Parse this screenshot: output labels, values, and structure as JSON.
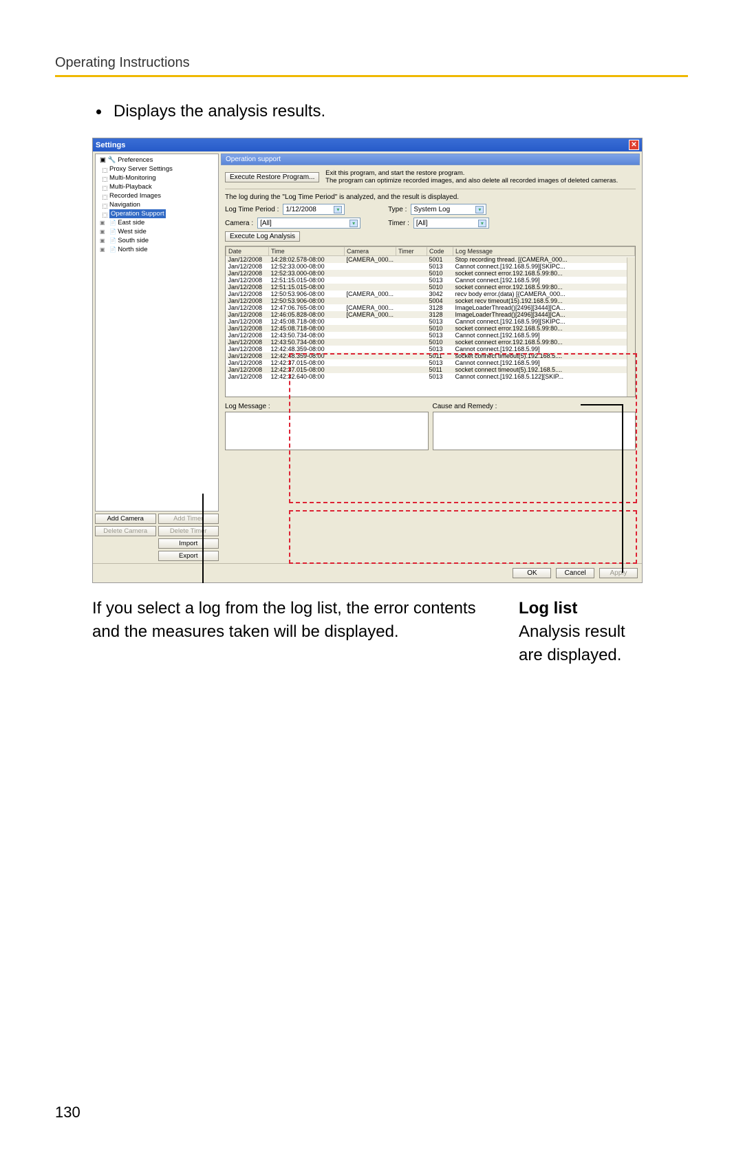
{
  "header": {
    "title": "Operating Instructions"
  },
  "bullet": "Displays the analysis results.",
  "window": {
    "title": "Settings",
    "section_title": "Operation support",
    "restore_btn": "Execute Restore Program...",
    "restore_desc1": "Exit this program, and start the restore program.",
    "restore_desc2": "The program can optimize recorded images, and also delete all recorded images of deleted cameras.",
    "analysis_note": "The log during the \"Log Time Period\" is analyzed, and the result is displayed.",
    "labels": {
      "log_time_period": "Log Time Period :",
      "type": "Type :",
      "camera": "Camera :",
      "timer": "Timer :",
      "execute_analysis": "Execute Log Analysis",
      "log_message": "Log Message :",
      "cause_remedy": "Cause and Remedy :"
    },
    "values": {
      "log_time_period": "1/12/2008",
      "type": "System Log",
      "camera": "[All]",
      "timer": "[All]"
    },
    "table_headers": [
      "Date",
      "Time",
      "Camera",
      "Timer",
      "Code",
      "Log Message"
    ],
    "rows": [
      {
        "d": "Jan/12/2008",
        "t": "14:28:02.578-08:00",
        "cam": "[CAMERA_000...",
        "tim": "",
        "c": "5001",
        "m": "Stop recording thread. [{CAMERA_000..."
      },
      {
        "d": "Jan/12/2008",
        "t": "12:52:33.000-08:00",
        "cam": "",
        "tim": "",
        "c": "5013",
        "m": "Cannot connect.[192.168.5.99][SKIPC..."
      },
      {
        "d": "Jan/12/2008",
        "t": "12:52:33.000-08:00",
        "cam": "",
        "tim": "",
        "c": "5010",
        "m": "socket connect error.192.168.5.99:80..."
      },
      {
        "d": "Jan/12/2008",
        "t": "12:51:15.015-08:00",
        "cam": "",
        "tim": "",
        "c": "5013",
        "m": "Cannot connect.[192.168.5.99]"
      },
      {
        "d": "Jan/12/2008",
        "t": "12:51:15.015-08:00",
        "cam": "",
        "tim": "",
        "c": "5010",
        "m": "socket connect error.192.168.5.99:80..."
      },
      {
        "d": "Jan/12/2008",
        "t": "12:50:53.906-08:00",
        "cam": "[CAMERA_000...",
        "tim": "",
        "c": "3042",
        "m": "recv body error.(data) [{CAMERA_000..."
      },
      {
        "d": "Jan/12/2008",
        "t": "12:50:53.906-08:00",
        "cam": "",
        "tim": "",
        "c": "5004",
        "m": "socket recv timeout(15).192.168.5.99..."
      },
      {
        "d": "Jan/12/2008",
        "t": "12:47:06.765-08:00",
        "cam": "[CAMERA_000...",
        "tim": "",
        "c": "3128",
        "m": "ImageLoaderThread()[2496][3444][CA..."
      },
      {
        "d": "Jan/12/2008",
        "t": "12:46:05.828-08:00",
        "cam": "[CAMERA_000...",
        "tim": "",
        "c": "3128",
        "m": "ImageLoaderThread()[2496][3444][CA..."
      },
      {
        "d": "Jan/12/2008",
        "t": "12:45:08.718-08:00",
        "cam": "",
        "tim": "",
        "c": "5013",
        "m": "Cannot connect.[192.168.5.99][SKIPC..."
      },
      {
        "d": "Jan/12/2008",
        "t": "12:45:08.718-08:00",
        "cam": "",
        "tim": "",
        "c": "5010",
        "m": "socket connect error.192.168.5.99:80..."
      },
      {
        "d": "Jan/12/2008",
        "t": "12:43:50.734-08:00",
        "cam": "",
        "tim": "",
        "c": "5013",
        "m": "Cannot connect.[192.168.5.99]"
      },
      {
        "d": "Jan/12/2008",
        "t": "12:43:50.734-08:00",
        "cam": "",
        "tim": "",
        "c": "5010",
        "m": "socket connect error.192.168.5.99:80..."
      },
      {
        "d": "Jan/12/2008",
        "t": "12:42:48.359-08:00",
        "cam": "",
        "tim": "",
        "c": "5013",
        "m": "Cannot connect.[192.168.5.99]"
      },
      {
        "d": "Jan/12/2008",
        "t": "12:42:48.359-08:00",
        "cam": "",
        "tim": "",
        "c": "5011",
        "m": "socket connect timeout(5).192.168.5...."
      },
      {
        "d": "Jan/12/2008",
        "t": "12:42:37.015-08:00",
        "cam": "",
        "tim": "",
        "c": "5013",
        "m": "Cannot connect.[192.168.5.99]"
      },
      {
        "d": "Jan/12/2008",
        "t": "12:42:37.015-08:00",
        "cam": "",
        "tim": "",
        "c": "5011",
        "m": "socket connect timeout(5).192.168.5...."
      },
      {
        "d": "Jan/12/2008",
        "t": "12:42:32.640-08:00",
        "cam": "",
        "tim": "",
        "c": "5013",
        "m": "Cannot connect.[192.168.5.122][SKIP..."
      }
    ],
    "tree": {
      "root": "Preferences",
      "items": [
        "Proxy Server Settings",
        "Multi-Monitoring",
        "Multi-Playback",
        "Recorded Images",
        "Navigation",
        "Operation Support"
      ],
      "groups": [
        "East side",
        "West side",
        "South side",
        "North side"
      ]
    },
    "side_buttons": {
      "add_camera": "Add Camera",
      "add_timer": "Add Timer",
      "delete_camera": "Delete Camera",
      "delete_timer": "Delete Timer",
      "import": "Import",
      "export": "Export"
    },
    "bottom": {
      "ok": "OK",
      "cancel": "Cancel",
      "apply": "Apply"
    }
  },
  "callouts": {
    "left": "If you select a log from the log list, the error contents and the measures taken will be displayed.",
    "right_title": "Log list",
    "right_l1": "Analysis result",
    "right_l2": "are displayed."
  },
  "page_number": "130"
}
